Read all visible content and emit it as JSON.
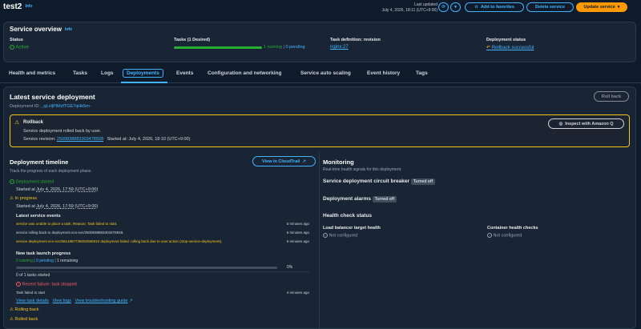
{
  "header": {
    "title": "test2",
    "info": "Info",
    "last_updated_label": "Last updated",
    "last_updated_value": "July 4, 2026, 18:11 (UTC+9:00)",
    "add_favorites": "Add to favorites",
    "delete_service": "Delete service",
    "update_service": "Update service"
  },
  "overview": {
    "title": "Service overview",
    "info": "Info",
    "status_label": "Status",
    "status_value": "Active",
    "tasks_label": "Tasks (1 Desired)",
    "tasks_running": "1 running",
    "tasks_pending": "0 pending",
    "tasks_fraction": 1,
    "taskdef_label": "Task definition: revision",
    "taskdef_value": "nginx:27",
    "deploy_status_label": "Deployment status",
    "deploy_status_value": "Rollback successful"
  },
  "tabs": [
    "Health and metrics",
    "Tasks",
    "Logs",
    "Deployments",
    "Events",
    "Configuration and networking",
    "Service auto scaling",
    "Event history",
    "Tags"
  ],
  "latest": {
    "title": "Latest service deployment",
    "deployment_id_label": "Deployment ID:",
    "deployment_id_value": "_qLvIjPlMzfTGE7qHk5m-",
    "roll_back": "Roll back"
  },
  "rollback_alert": {
    "title": "Rollback",
    "message": "Service deployment rolled back by user.",
    "revision_label": "Service revision:",
    "revision_value": "2500838883303478928",
    "started": "Started at: July 4, 2026, 18:10 (UTC+9:00)",
    "inspect": "Inspect with Amazon Q"
  },
  "timeline": {
    "title": "Deployment timeline",
    "subtitle": "Track the progress of each deployment phase.",
    "view_cloudtrail": "View in CloudTrail",
    "started_status": "Deployment started",
    "started_at_label": "Started at",
    "started_at_value": "July 4, 2026, 17:59 (UTC+9:00)",
    "inprogress_status": "In progress",
    "inprogress_at_label": "Started at",
    "inprogress_at_value": "July 4, 2026, 17:59 (UTC+9:00)",
    "events_title": "Latest service events",
    "events": [
      {
        "text": "service was unable to place a task. Reason: Task failed to start.",
        "time": "5 minutes ago",
        "tone": "amber"
      },
      {
        "text": "service rolling back to deployment ecs-svc/2500838883303478928.",
        "time": "5 minutes ago",
        "tone": "plain"
      },
      {
        "text": "service deployment ecs-svc/6814887735002066810 deployment failed: rolling back due to user action (stop-service-deployment).",
        "time": "5 minutes ago",
        "tone": "amber"
      }
    ],
    "launch_title": "New task launch progress",
    "launch_running": "0 running",
    "launch_pending": "0 pending",
    "launch_remaining": "1 remaining",
    "launch_percent": "0%",
    "launch_fraction": 0,
    "tasks_started": "0 of 1 tasks started",
    "failure_title": "Recent failure: task stopped",
    "failure_text": "Task failed to start",
    "failure_time": "4 minutes ago",
    "view_task_details": "View task details",
    "view_logs": "View logs",
    "view_troubleshooting": "View troubleshooting guide",
    "rolling_back": "Rolling back",
    "rolled_back": "Rolled back"
  },
  "monitoring": {
    "title": "Monitoring",
    "subtitle": "Real-time health signals for this deployment.",
    "circuit_breaker": "Service deployment circuit breaker",
    "circuit_breaker_badge": "Turned off",
    "alarms": "Deployment alarms",
    "alarms_badge": "Turned off",
    "health_title": "Health check status",
    "lb_label": "Load balancer target health",
    "lb_value": "Not configured",
    "container_label": "Container health checks",
    "container_value": "Not configured"
  }
}
